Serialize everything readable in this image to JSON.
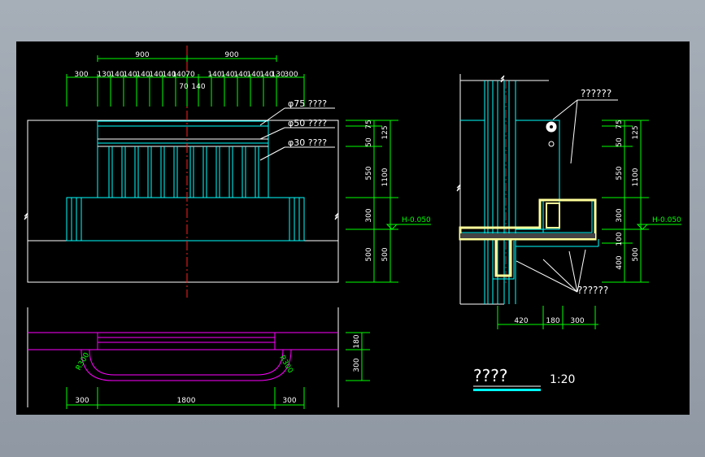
{
  "colors": {
    "background": "#000000",
    "frame": "#9aa3ad",
    "dimension": "#00ff00",
    "outline": "#ffffff",
    "detail": "#00ffff",
    "centerline": "#ff2020",
    "rail": "#ff00ff",
    "concrete": "#ffff9a",
    "title_bar": "#00ffff"
  },
  "elevation": {
    "top_dims": [
      "900",
      "900"
    ],
    "sub_dims_left": [
      "300",
      "130",
      "140",
      "140",
      "140",
      "140",
      "140",
      "140"
    ],
    "center_dims": [
      "70",
      "70"
    ],
    "below_center": [
      "70",
      "140"
    ],
    "sub_dims_right": [
      "140",
      "140",
      "140",
      "140",
      "140",
      "130",
      "300"
    ],
    "labels": [
      "φ75 ????",
      "φ50 ????",
      "φ30 ????"
    ],
    "right_dims_inner": [
      "75",
      "50",
      "550",
      "300",
      "500"
    ],
    "right_dims_outer": [
      "125",
      "1100",
      "500"
    ],
    "level": "H-0.050"
  },
  "plan": {
    "right_dims": [
      "180",
      "300"
    ],
    "radius_left": "R300",
    "radius_right": "R300",
    "bottom_dims": [
      "300",
      "1800",
      "300"
    ]
  },
  "section": {
    "top_label": "??????",
    "bottom_label": "??????",
    "right_dims_inner": [
      "75",
      "50",
      "550",
      "300",
      "100",
      "400"
    ],
    "right_dims_outer": [
      "125",
      "1100",
      "500"
    ],
    "level": "H-0.050",
    "bottom_dims": [
      "420",
      "180",
      "300"
    ]
  },
  "title": {
    "text": "????",
    "scale": "1:20"
  }
}
